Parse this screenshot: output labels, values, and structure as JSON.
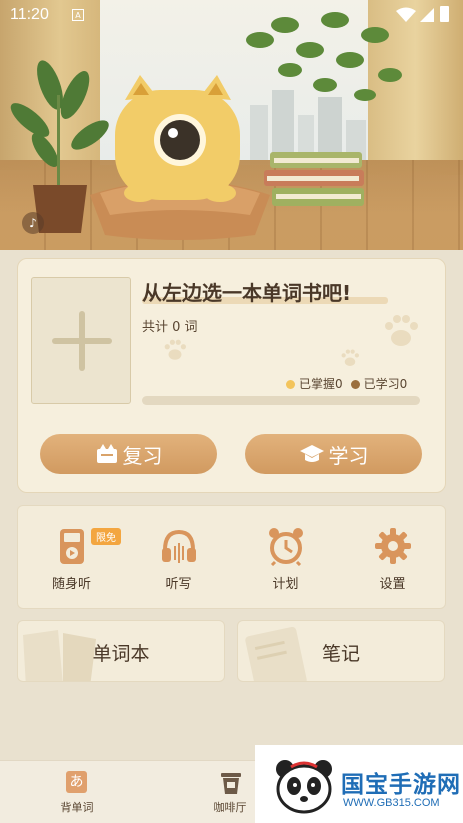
{
  "status_bar": {
    "time": "11:20",
    "sim_label": "A"
  },
  "book": {
    "title": "从左边选一本单词书吧!",
    "total": "共计 0 词",
    "mastered": "已掌握0",
    "learned": "已学习0",
    "progress": 0
  },
  "actions": {
    "review": "复习",
    "learn": "学习"
  },
  "tools": [
    {
      "label": "随身听",
      "badge": "限免",
      "icon": "walkman-icon"
    },
    {
      "label": "听写",
      "icon": "headphones-icon"
    },
    {
      "label": "计划",
      "icon": "alarm-clock-icon"
    },
    {
      "label": "设置",
      "icon": "gear-icon"
    }
  ],
  "tiles": {
    "words": "单词本",
    "notes": "笔记"
  },
  "nav": {
    "words": {
      "label": "背单词",
      "icon_text": "あ"
    },
    "cafe": {
      "label": "咖啡厅"
    }
  },
  "watermark": {
    "brand": "国宝手游网",
    "site": "WWW.GB315.COM"
  },
  "colors": {
    "accent": "#d9a36a",
    "mastered": "#f3c45c",
    "learned": "#9b6f3e",
    "watermark": "#1f6db6"
  }
}
